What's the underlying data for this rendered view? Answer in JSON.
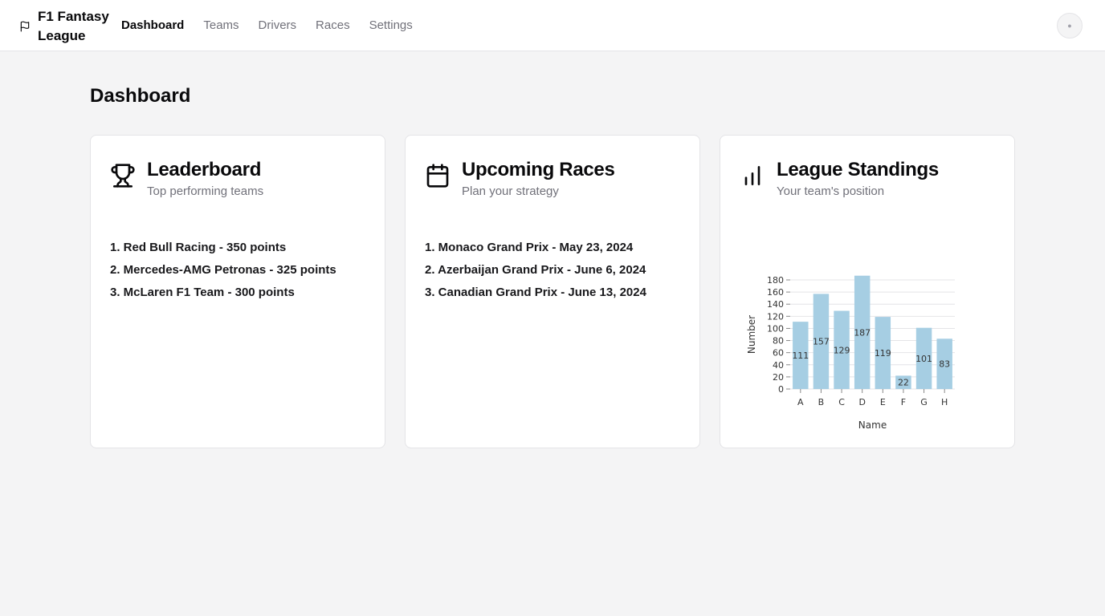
{
  "app": {
    "title": "F1 Fantasy League"
  },
  "nav": {
    "items": [
      {
        "label": "Dashboard",
        "active": true
      },
      {
        "label": "Teams",
        "active": false
      },
      {
        "label": "Drivers",
        "active": false
      },
      {
        "label": "Races",
        "active": false
      },
      {
        "label": "Settings",
        "active": false
      }
    ]
  },
  "user": {
    "avatar_icon": "user-avatar-icon"
  },
  "page": {
    "title": "Dashboard"
  },
  "cards": {
    "leaderboard": {
      "icon": "trophy-icon",
      "title": "Leaderboard",
      "subtitle": "Top performing teams",
      "items": [
        "1. Red Bull Racing - 350 points",
        "2. Mercedes-AMG Petronas - 325 points",
        "3. McLaren F1 Team - 300 points"
      ]
    },
    "races": {
      "icon": "calendar-icon",
      "title": "Upcoming Races",
      "subtitle": "Plan your strategy",
      "items": [
        "1. Monaco Grand Prix - May 23, 2024",
        "2. Azerbaijan Grand Prix - June 6, 2024",
        "3. Canadian Grand Prix - June 13, 2024"
      ]
    },
    "standings": {
      "icon": "bar-chart-icon",
      "title": "League Standings",
      "subtitle": "Your team's position"
    }
  },
  "chart_data": {
    "type": "bar",
    "categories": [
      "A",
      "B",
      "C",
      "D",
      "E",
      "F",
      "G",
      "H"
    ],
    "values": [
      111,
      157,
      129,
      187,
      119,
      22,
      101,
      83
    ],
    "xlabel": "Name",
    "ylabel": "Number",
    "ylim": [
      0,
      180
    ],
    "yticks": [
      0,
      20,
      40,
      60,
      80,
      100,
      120,
      140,
      160,
      180
    ],
    "grid": true,
    "bar_color": "#a6cee3",
    "data_labels": true
  }
}
